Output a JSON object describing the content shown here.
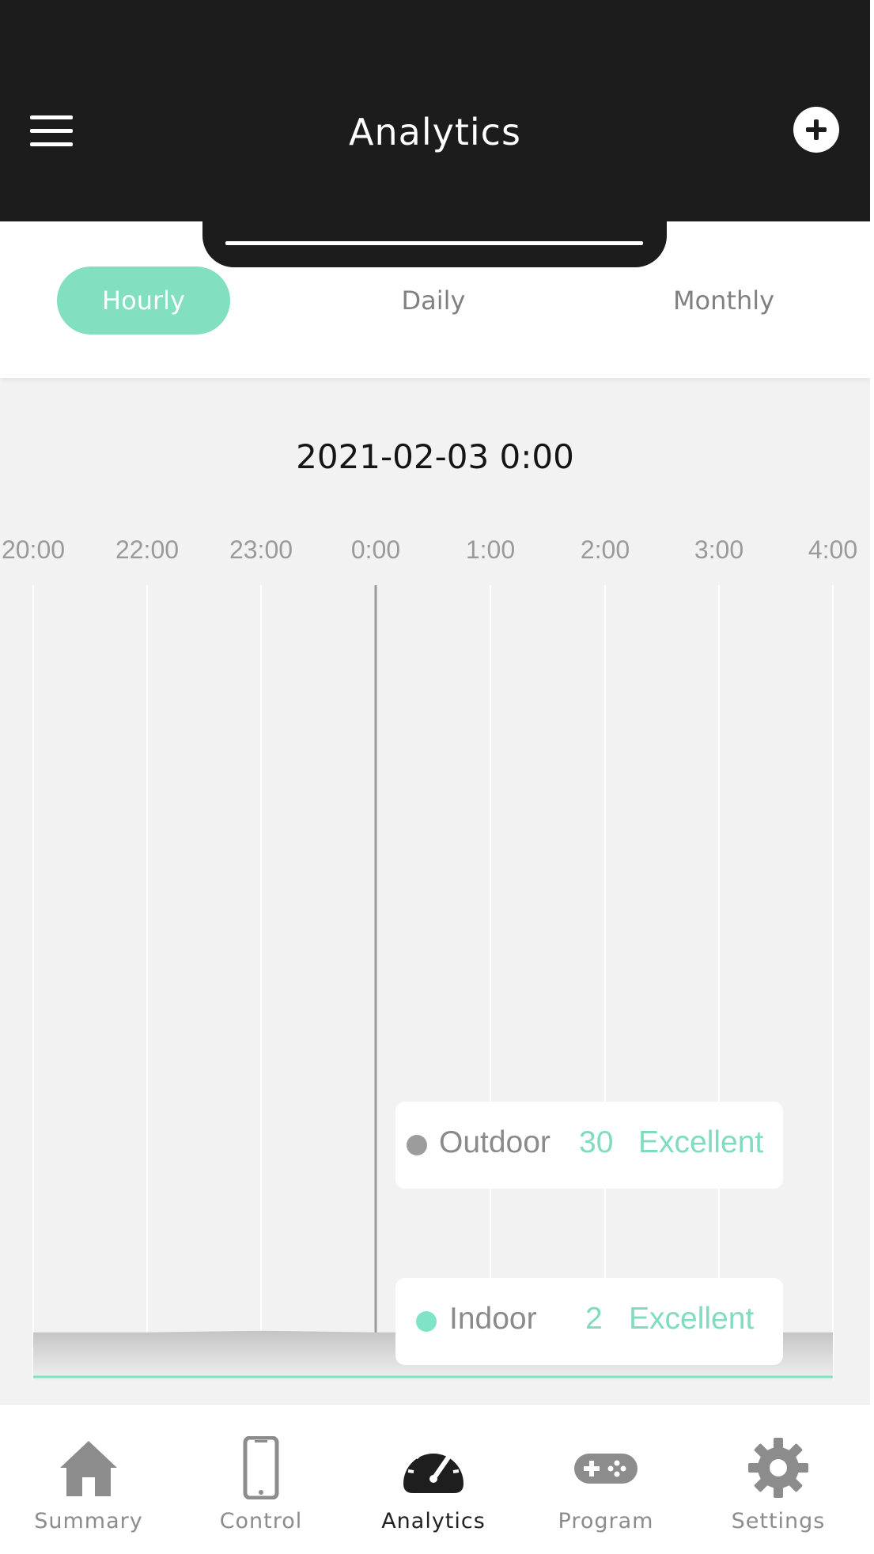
{
  "header": {
    "title": "Analytics"
  },
  "tabs": [
    {
      "label": "Hourly",
      "active": true
    },
    {
      "label": "Daily",
      "active": false
    },
    {
      "label": "Monthly",
      "active": false
    }
  ],
  "selected_time": "2021-02-03 0:00",
  "chart_data": {
    "type": "area",
    "x": [
      "20:00",
      "22:00",
      "23:00",
      "0:00",
      "1:00",
      "2:00",
      "3:00",
      "4:00"
    ],
    "selected": "0:00",
    "series": [
      {
        "name": "Outdoor",
        "values": [
          30,
          30,
          31,
          30,
          30,
          30,
          30,
          30
        ],
        "color": "#9c9c9c"
      },
      {
        "name": "Indoor",
        "values": [
          2,
          2,
          2,
          2,
          2,
          2,
          2,
          2
        ],
        "color": "#7fe4c6"
      }
    ],
    "ylim": [
      0,
      500
    ],
    "grid": true
  },
  "tooltips": {
    "outdoor": {
      "name": "Outdoor",
      "value": "30",
      "status": "Excellent"
    },
    "indoor": {
      "name": "Indoor",
      "value": "2",
      "status": "Excellent"
    }
  },
  "nav": [
    {
      "label": "Summary",
      "icon": "home-icon",
      "active": false
    },
    {
      "label": "Control",
      "icon": "phone-icon",
      "active": false
    },
    {
      "label": "Analytics",
      "icon": "gauge-icon",
      "active": true
    },
    {
      "label": "Program",
      "icon": "gamepad-icon",
      "active": false
    },
    {
      "label": "Settings",
      "icon": "gear-icon",
      "active": false
    }
  ],
  "colors": {
    "header_bg": "#1c1c1c",
    "accent": "#82e0c0",
    "page_bg": "#f2f2f2"
  }
}
